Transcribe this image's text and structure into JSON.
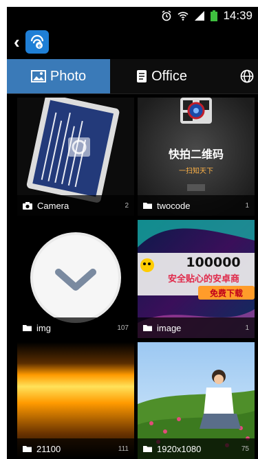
{
  "status_bar": {
    "time": "14:39"
  },
  "tabs": [
    {
      "label": "Photo",
      "icon": "image-icon",
      "active": true
    },
    {
      "label": "Office",
      "icon": "document-icon",
      "active": false
    },
    {
      "label": "",
      "icon": "globe-icon",
      "active": false
    }
  ],
  "albums": [
    {
      "name": "Camera",
      "count": "2",
      "icon": "camera-icon"
    },
    {
      "name": "twocode",
      "count": "1",
      "icon": "folder-icon"
    },
    {
      "name": "img",
      "count": "107",
      "icon": "folder-icon"
    },
    {
      "name": "image",
      "count": "1",
      "icon": "folder-icon"
    },
    {
      "name": "21100",
      "count": "111",
      "icon": "folder-icon"
    },
    {
      "name": "1920x1080",
      "count": "75",
      "icon": "folder-icon"
    }
  ],
  "thumbnails": {
    "twocode_title": "快拍二维码",
    "twocode_sub": "一扫知天下",
    "image_big": "100000",
    "image_line2": "安全贴心的安卓商",
    "image_button": "免费下载"
  }
}
